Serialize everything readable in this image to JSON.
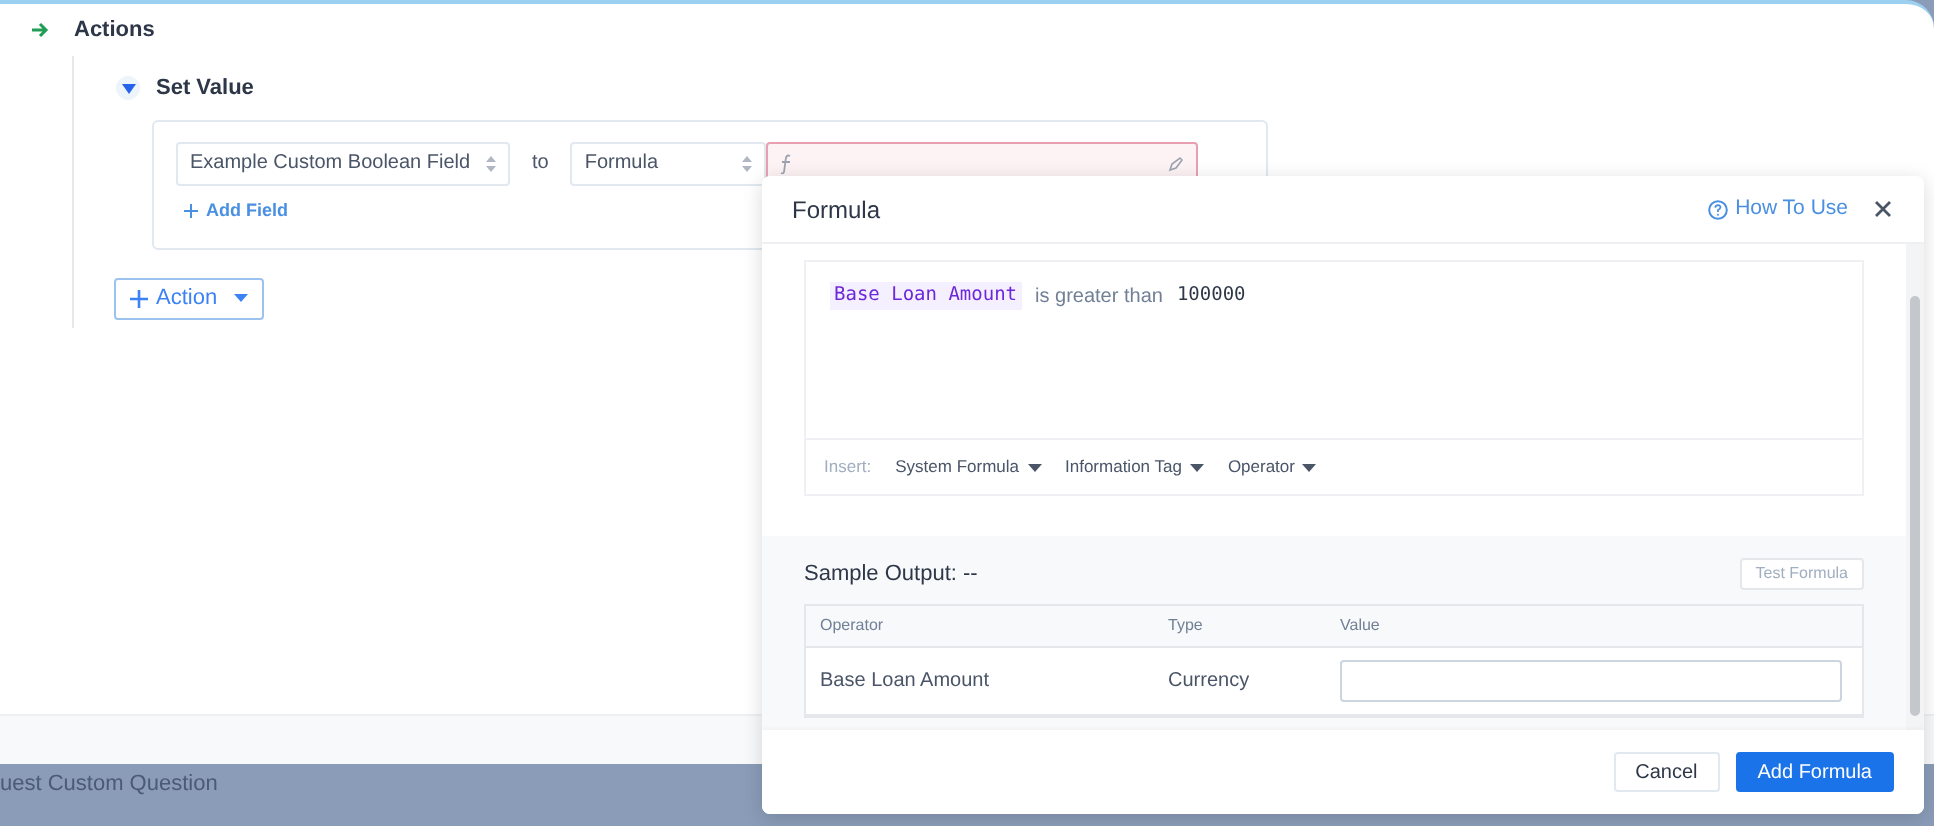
{
  "actions": {
    "title": "Actions",
    "set_value": {
      "title": "Set Value",
      "expanded": true,
      "field": "Example Custom Boolean Field",
      "connector": "to",
      "mode": "Formula",
      "add_field": "Add Field"
    },
    "add_action": "Action"
  },
  "background_row": "uest Custom Question",
  "formula_dialog": {
    "title": "Formula",
    "help_link": "How To Use",
    "expression": [
      {
        "kind": "tag",
        "text": "Base Loan Amount"
      },
      {
        "kind": "operator",
        "text": "is greater than"
      },
      {
        "kind": "number",
        "text": "100000"
      }
    ],
    "insert_label": "Insert:",
    "insert_menus": [
      "System Formula",
      "Information Tag",
      "Operator"
    ],
    "sample_output": {
      "label": "Sample Output:",
      "value": "--"
    },
    "test_button": "Test Formula",
    "table": {
      "columns": [
        "Operator",
        "Type",
        "Value"
      ],
      "rows": [
        {
          "operator": "Base Loan Amount",
          "type": "Currency",
          "value": ""
        }
      ]
    },
    "buttons": [
      {
        "label": "Cancel",
        "kind": "secondary"
      },
      {
        "label": "Add Formula",
        "kind": "primary"
      }
    ]
  }
}
